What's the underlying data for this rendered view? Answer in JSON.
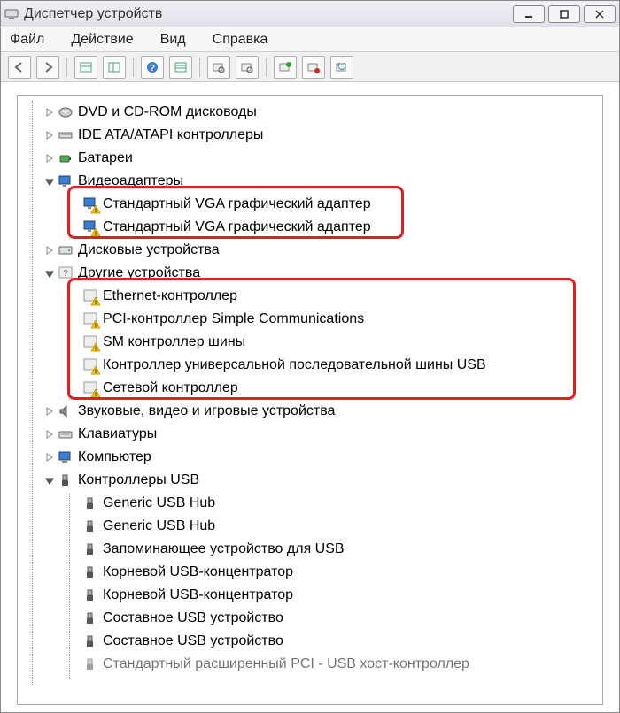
{
  "window": {
    "title": "Диспетчер устройств"
  },
  "menu": {
    "file": "Файл",
    "action": "Действие",
    "view": "Вид",
    "help": "Справка"
  },
  "tree": {
    "dvd": "DVD и CD-ROM дисководы",
    "ide": "IDE ATA/ATAPI контроллеры",
    "battery": "Батареи",
    "video": "Видеоадаптеры",
    "video_child1": "Стандартный VGA графический адаптер",
    "video_child2": "Стандартный VGA графический адаптер",
    "disk": "Дисковые устройства",
    "other": "Другие устройства",
    "other_ethernet": "Ethernet-контроллер",
    "other_pci": "PCI-контроллер Simple Communications",
    "other_sm": "SM контроллер шины",
    "other_usb": "Контроллер универсальной последовательной шины USB",
    "other_net": "Сетевой контроллер",
    "audio": "Звуковые, видео и игровые устройства",
    "keyboards": "Клавиатуры",
    "computer": "Компьютер",
    "usb_controllers": "Контроллеры USB",
    "usb1": "Generic USB Hub",
    "usb2": "Generic USB Hub",
    "usb3": "Запоминающее устройство для USB",
    "usb4": "Корневой USB-концентратор",
    "usb5": "Корневой USB-концентратор",
    "usb6": "Составное USB устройство",
    "usb7": "Составное USB устройство",
    "usb8": "Стандартный расширенный PCI - USB хост-контроллер"
  }
}
